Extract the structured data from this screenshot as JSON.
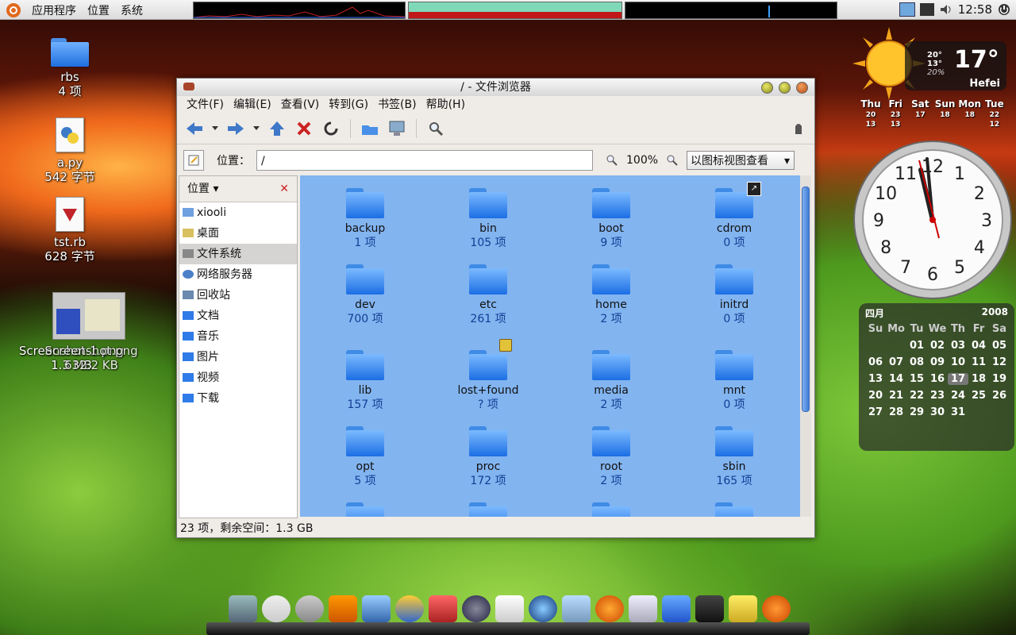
{
  "top_panel": {
    "menus": [
      "应用程序",
      "位置",
      "系统"
    ],
    "clock": "12:58"
  },
  "desktop_icons": [
    {
      "name": "rbs",
      "detail": "4 项"
    },
    {
      "name": "a.py",
      "detail": "542 字节"
    },
    {
      "name": "tst.rb",
      "detail": "628 字节"
    },
    {
      "name": "Screenshot-1.png",
      "detail": "1.3 MB"
    },
    {
      "name": "Screenshot.png",
      "detail": "632.2 KB"
    }
  ],
  "window": {
    "title": "/ - 文件浏览器",
    "menus": [
      "文件(F)",
      "编辑(E)",
      "查看(V)",
      "转到(G)",
      "书签(B)",
      "帮助(H)"
    ],
    "location_label": "位置：",
    "location_value": "/",
    "zoom": "100%",
    "view_mode": "以图标视图查看",
    "sidebar_header": "位置",
    "sidebar_items": [
      "xiooli",
      "桌面",
      "文件系统",
      "网络服务器",
      "回收站",
      "文档",
      "音乐",
      "图片",
      "视频",
      "下载"
    ],
    "files": [
      {
        "name": "backup",
        "count": "1 项"
      },
      {
        "name": "bin",
        "count": "105 项"
      },
      {
        "name": "boot",
        "count": "9 项"
      },
      {
        "name": "cdrom",
        "count": "0 项"
      },
      {
        "name": "dev",
        "count": "700 项"
      },
      {
        "name": "etc",
        "count": "261 项"
      },
      {
        "name": "home",
        "count": "2 项"
      },
      {
        "name": "initrd",
        "count": "0 项"
      },
      {
        "name": "lib",
        "count": "157 项"
      },
      {
        "name": "lost+found",
        "count": "? 项"
      },
      {
        "name": "media",
        "count": "2 项"
      },
      {
        "name": "mnt",
        "count": "0 项"
      },
      {
        "name": "opt",
        "count": "5 项"
      },
      {
        "name": "proc",
        "count": "172 项"
      },
      {
        "name": "root",
        "count": "2 项"
      },
      {
        "name": "sbin",
        "count": "165 项"
      }
    ],
    "status": "23 项，剩余空间：1.3 GB"
  },
  "weather": {
    "temp": "17°",
    "high": "20°",
    "low": "13°",
    "humidity": "20%",
    "city": "Hefei",
    "days": [
      {
        "day": "Thu",
        "hi": "20",
        "lo": "13"
      },
      {
        "day": "Fri",
        "hi": "23",
        "lo": "13"
      },
      {
        "day": "Sat",
        "hi": "17",
        "lo": ""
      },
      {
        "day": "Sun",
        "hi": "18",
        "lo": ""
      },
      {
        "day": "Mon",
        "hi": "18",
        "lo": ""
      },
      {
        "day": "Tue",
        "hi": "22",
        "lo": "12"
      }
    ]
  },
  "clock_widget": {
    "numerals": [
      "12",
      "1",
      "2",
      "3",
      "4",
      "5",
      "6",
      "7",
      "8",
      "9",
      "10",
      "11"
    ]
  },
  "calendar": {
    "month": "四月",
    "year": "2008",
    "weekdays": [
      "Su",
      "Mo",
      "Tu",
      "We",
      "Th",
      "Fr",
      "Sa"
    ],
    "days": [
      "",
      "",
      "01",
      "02",
      "03",
      "04",
      "05",
      "06",
      "07",
      "08",
      "09",
      "10",
      "11",
      "12",
      "13",
      "14",
      "15",
      "16",
      "17",
      "18",
      "19",
      "20",
      "21",
      "22",
      "23",
      "24",
      "25",
      "26",
      "27",
      "28",
      "29",
      "30",
      "31"
    ],
    "today": "17"
  },
  "colors": {
    "content_bg": "#82b4f0",
    "count_text": "#143d94",
    "folder": "#1f6fe0"
  }
}
